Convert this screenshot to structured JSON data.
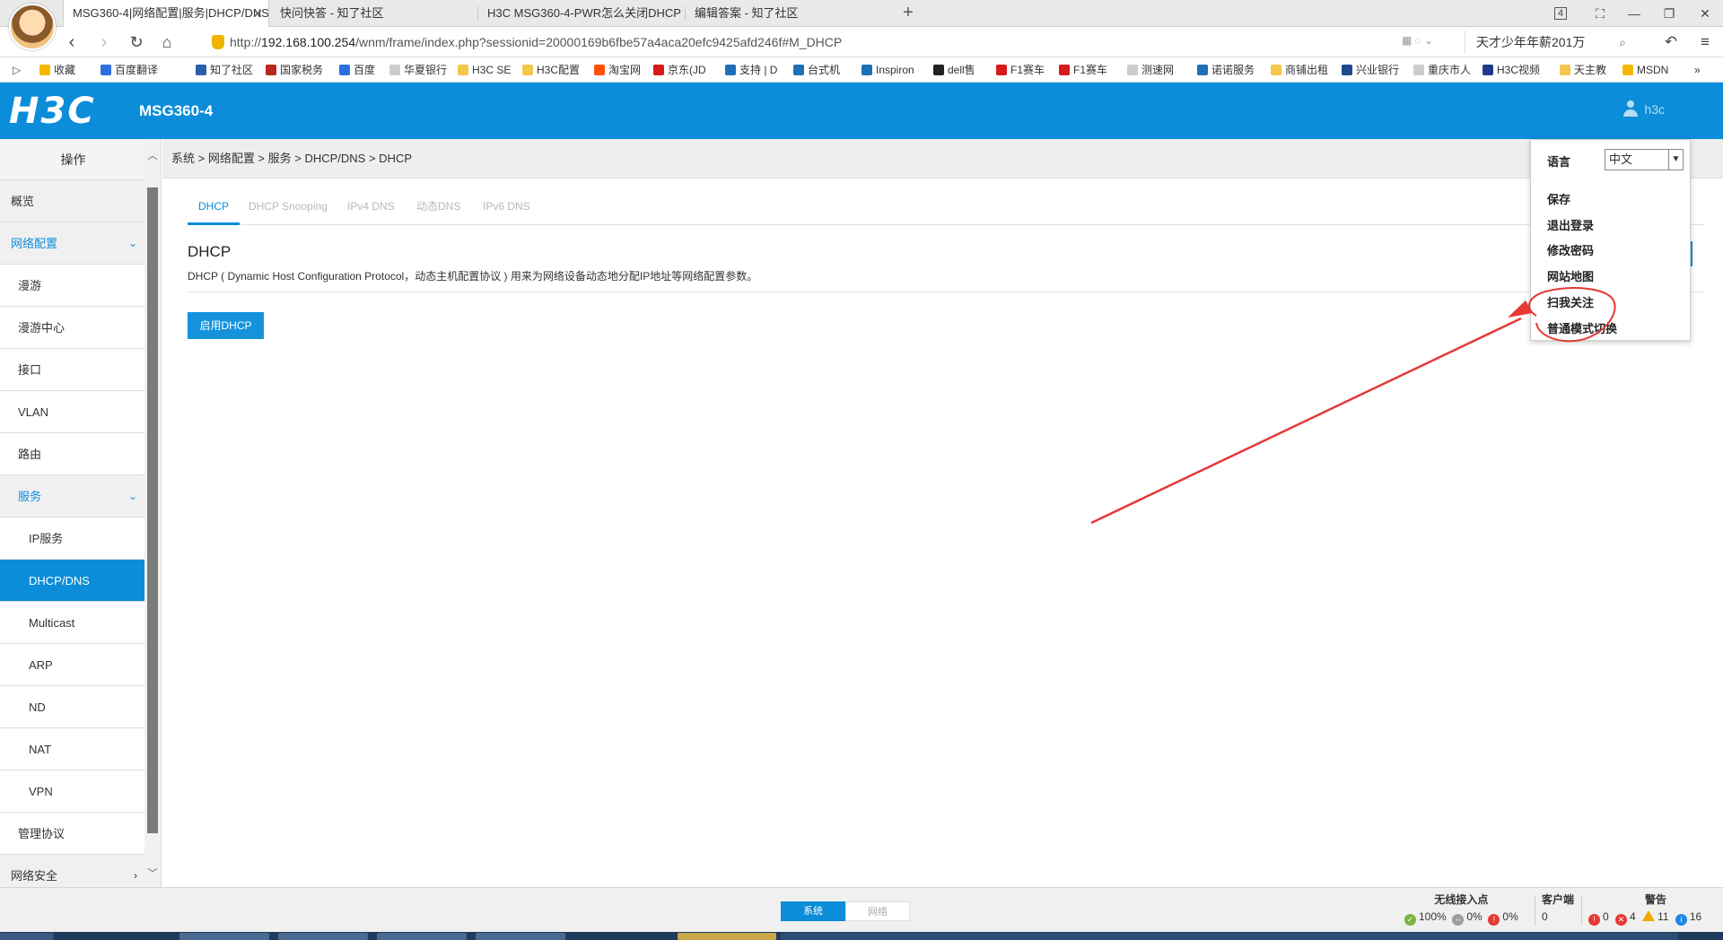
{
  "browser": {
    "tabs": [
      {
        "title": "MSG360-4|网络配置|服务|DHCP/DNS",
        "active": true
      },
      {
        "title": "快问快答 - 知了社区"
      },
      {
        "title": "H3C MSG360-4-PWR怎么关闭DHCP"
      },
      {
        "title": "编辑答案 - 知了社区"
      }
    ],
    "tab_count": "4",
    "url_prefix": "http://",
    "url_host": "192.168.100.254",
    "url_path": "/wnm/frame/index.php?sessionid=20000169b6fbe57a4aca20efc9425afd246f#M_DHCP",
    "search_text": "天才少年年薪201万",
    "bookmarks": [
      {
        "label": "收藏",
        "color": "#f5b800"
      },
      {
        "label": "百度翻译",
        "color": "#2c6fe0"
      },
      {
        "label": "知了社区",
        "color": "#2b5fa8"
      },
      {
        "label": "国家税务",
        "color": "#b8281e"
      },
      {
        "label": "百度",
        "color": "#2c6fe0"
      },
      {
        "label": "华夏银行",
        "color": "#cccccc"
      },
      {
        "label": "H3C SE",
        "color": "#f3c84a"
      },
      {
        "label": "H3C配置",
        "color": "#f3c84a"
      },
      {
        "label": "淘宝网",
        "color": "#ff5000"
      },
      {
        "label": "京东(JD",
        "color": "#d71a1a"
      },
      {
        "label": "支持 | D",
        "color": "#1f6fb5"
      },
      {
        "label": "台式机",
        "color": "#1f6fb5"
      },
      {
        "label": "Inspiron",
        "color": "#1f6fb5"
      },
      {
        "label": "dell售",
        "color": "#222222"
      },
      {
        "label": "F1赛车",
        "color": "#d71a1a"
      },
      {
        "label": "F1赛车",
        "color": "#d71a1a"
      },
      {
        "label": "测速网",
        "color": "#cccccc"
      },
      {
        "label": "诺诺服务",
        "color": "#1f6fb5"
      },
      {
        "label": "商铺出租",
        "color": "#f3c84a"
      },
      {
        "label": "兴业银行",
        "color": "#1f4a8a"
      },
      {
        "label": "重庆市人",
        "color": "#cccccc"
      },
      {
        "label": "H3C视频",
        "color": "#1f3a8a"
      },
      {
        "label": "天主教",
        "color": "#f3c84a"
      },
      {
        "label": "MSDN",
        "color": "#f5b800"
      }
    ]
  },
  "app": {
    "logo": "H3C",
    "model": "MSG360-4",
    "user": "h3c"
  },
  "sidebar": {
    "header": "操作",
    "items": [
      {
        "label": "概览",
        "level": 0
      },
      {
        "label": "网络配置",
        "level": 0,
        "open": true,
        "chevron": "⌄"
      },
      {
        "label": "漫游",
        "level": 1
      },
      {
        "label": "漫游中心",
        "level": 1
      },
      {
        "label": "接口",
        "level": 1
      },
      {
        "label": "VLAN",
        "level": 1
      },
      {
        "label": "路由",
        "level": 1
      },
      {
        "label": "服务",
        "level": 1,
        "open": true,
        "chevron": "⌄"
      },
      {
        "label": "IP服务",
        "level": 2
      },
      {
        "label": "DHCP/DNS",
        "level": 2,
        "selected": true
      },
      {
        "label": "Multicast",
        "level": 2
      },
      {
        "label": "ARP",
        "level": 2
      },
      {
        "label": "ND",
        "level": 2
      },
      {
        "label": "NAT",
        "level": 2
      },
      {
        "label": "VPN",
        "level": 2
      },
      {
        "label": "管理协议",
        "level": 1
      },
      {
        "label": "网络安全",
        "level": 0,
        "chevron": "›"
      }
    ]
  },
  "breadcrumb": "系统 > 网络配置 > 服务 > DHCP/DNS > DHCP",
  "content": {
    "tabs": [
      "DHCP",
      "DHCP Snooping",
      "IPv4 DNS",
      "动态DNS",
      "IPv6 DNS"
    ],
    "active_tab": 0,
    "title": "DHCP",
    "description": "DHCP ( Dynamic Host Configuration Protocol，动态主机配置协议 ) 用来为网络设备动态地分配IP地址等网络配置参数。",
    "enable_button": "启用DHCP"
  },
  "user_menu": {
    "language_label": "语言",
    "language_value": "中文",
    "items": [
      "保存",
      "退出登录",
      "修改密码",
      "网站地图",
      "扫我关注",
      "普通模式切换"
    ]
  },
  "statusbar": {
    "toggle_on": "系统",
    "toggle_off": "网络",
    "wireless_ap": {
      "title": "无线接入点",
      "online": "100%",
      "offline": "0%",
      "fault": "0%"
    },
    "clients": {
      "title": "客户端",
      "count": "0"
    },
    "alarms": {
      "title": "警告",
      "critical": "0",
      "major": "4",
      "minor": "11",
      "info": "16"
    }
  },
  "colors": {
    "accent": "#0b8dd9",
    "annotation": "#e53935"
  }
}
